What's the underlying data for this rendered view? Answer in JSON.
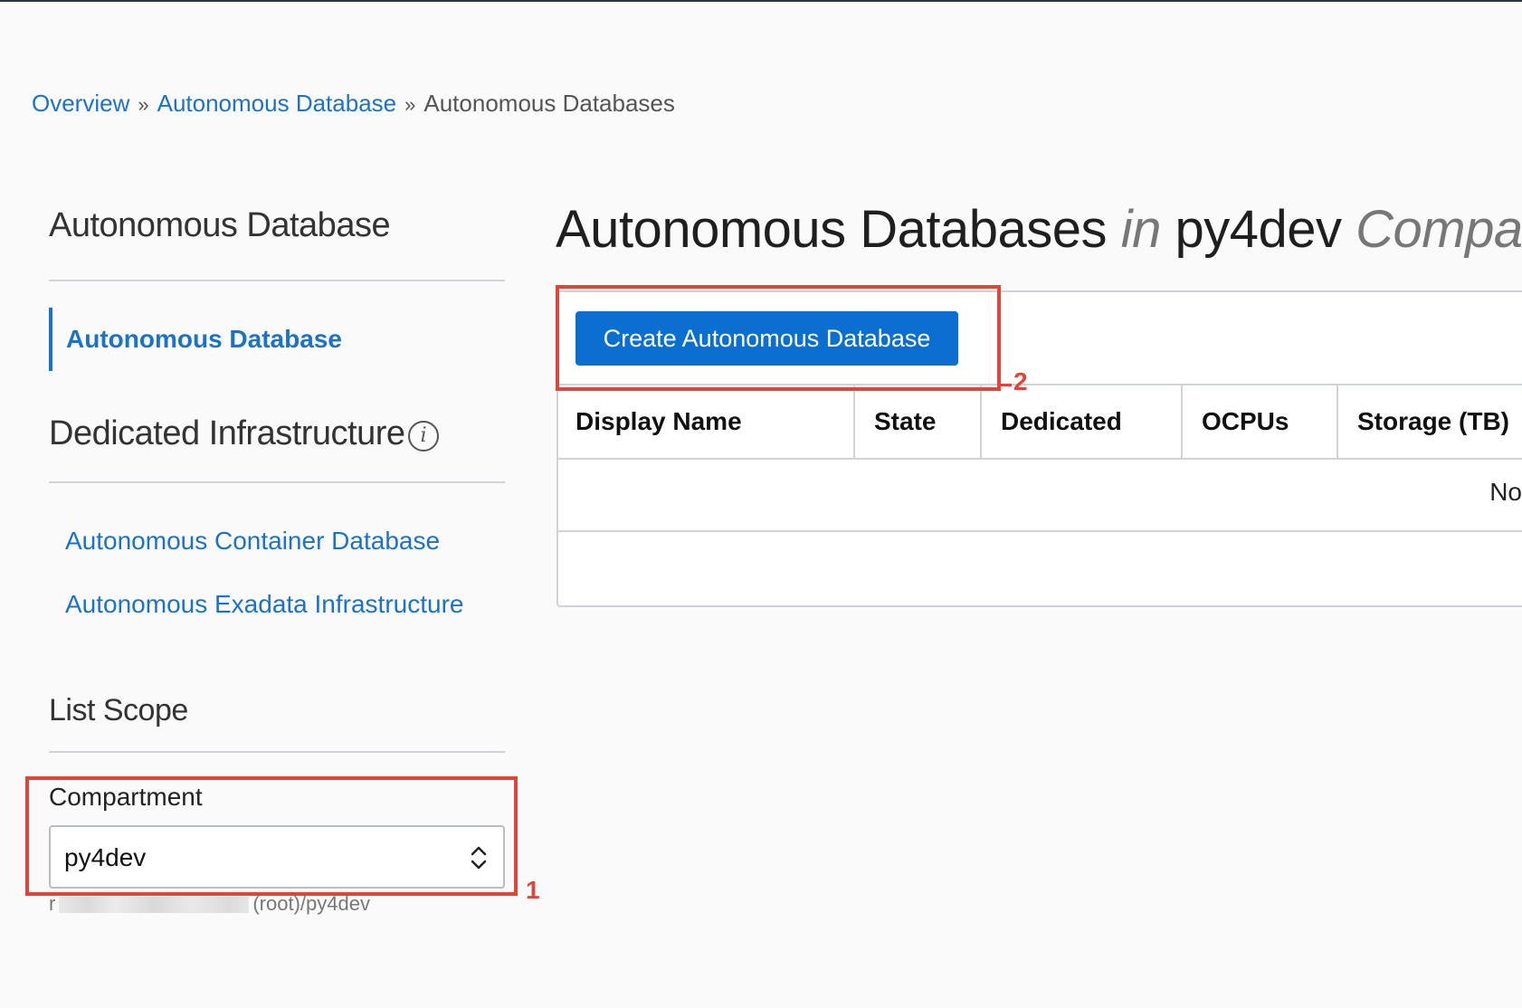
{
  "breadcrumb": {
    "items": [
      "Overview",
      "Autonomous Database"
    ],
    "separator": "»",
    "current": "Autonomous Databases"
  },
  "sidebar": {
    "section1_heading": "Autonomous Database",
    "active_item": "Autonomous Database",
    "section2_heading": "Dedicated Infrastructure",
    "info_glyph": "i",
    "links": [
      "Autonomous Container Database",
      "Autonomous Exadata Infrastructure"
    ],
    "section3_heading": "List Scope",
    "compartment_label": "Compartment",
    "compartment_value": "py4dev",
    "compartment_path_prefix": "r",
    "compartment_path_suffix": "(root)/py4dev"
  },
  "main": {
    "title": {
      "part1": "Autonomous Databases",
      "in": "in",
      "compartment": "py4dev",
      "suffix": "Compar"
    },
    "create_button": "Create Autonomous Database",
    "columns": [
      "Display Name",
      "State",
      "Dedicated",
      "OCPUs",
      "Storage (TB)"
    ],
    "empty_text": "No"
  },
  "annotations": [
    "1",
    "2"
  ],
  "colors": {
    "accent": "#1a73c9",
    "button": "#0b6fd1",
    "annotation": "#e0453a"
  },
  "icons": {
    "info": "info-icon",
    "select_chevron": "chevron-updown-icon"
  }
}
